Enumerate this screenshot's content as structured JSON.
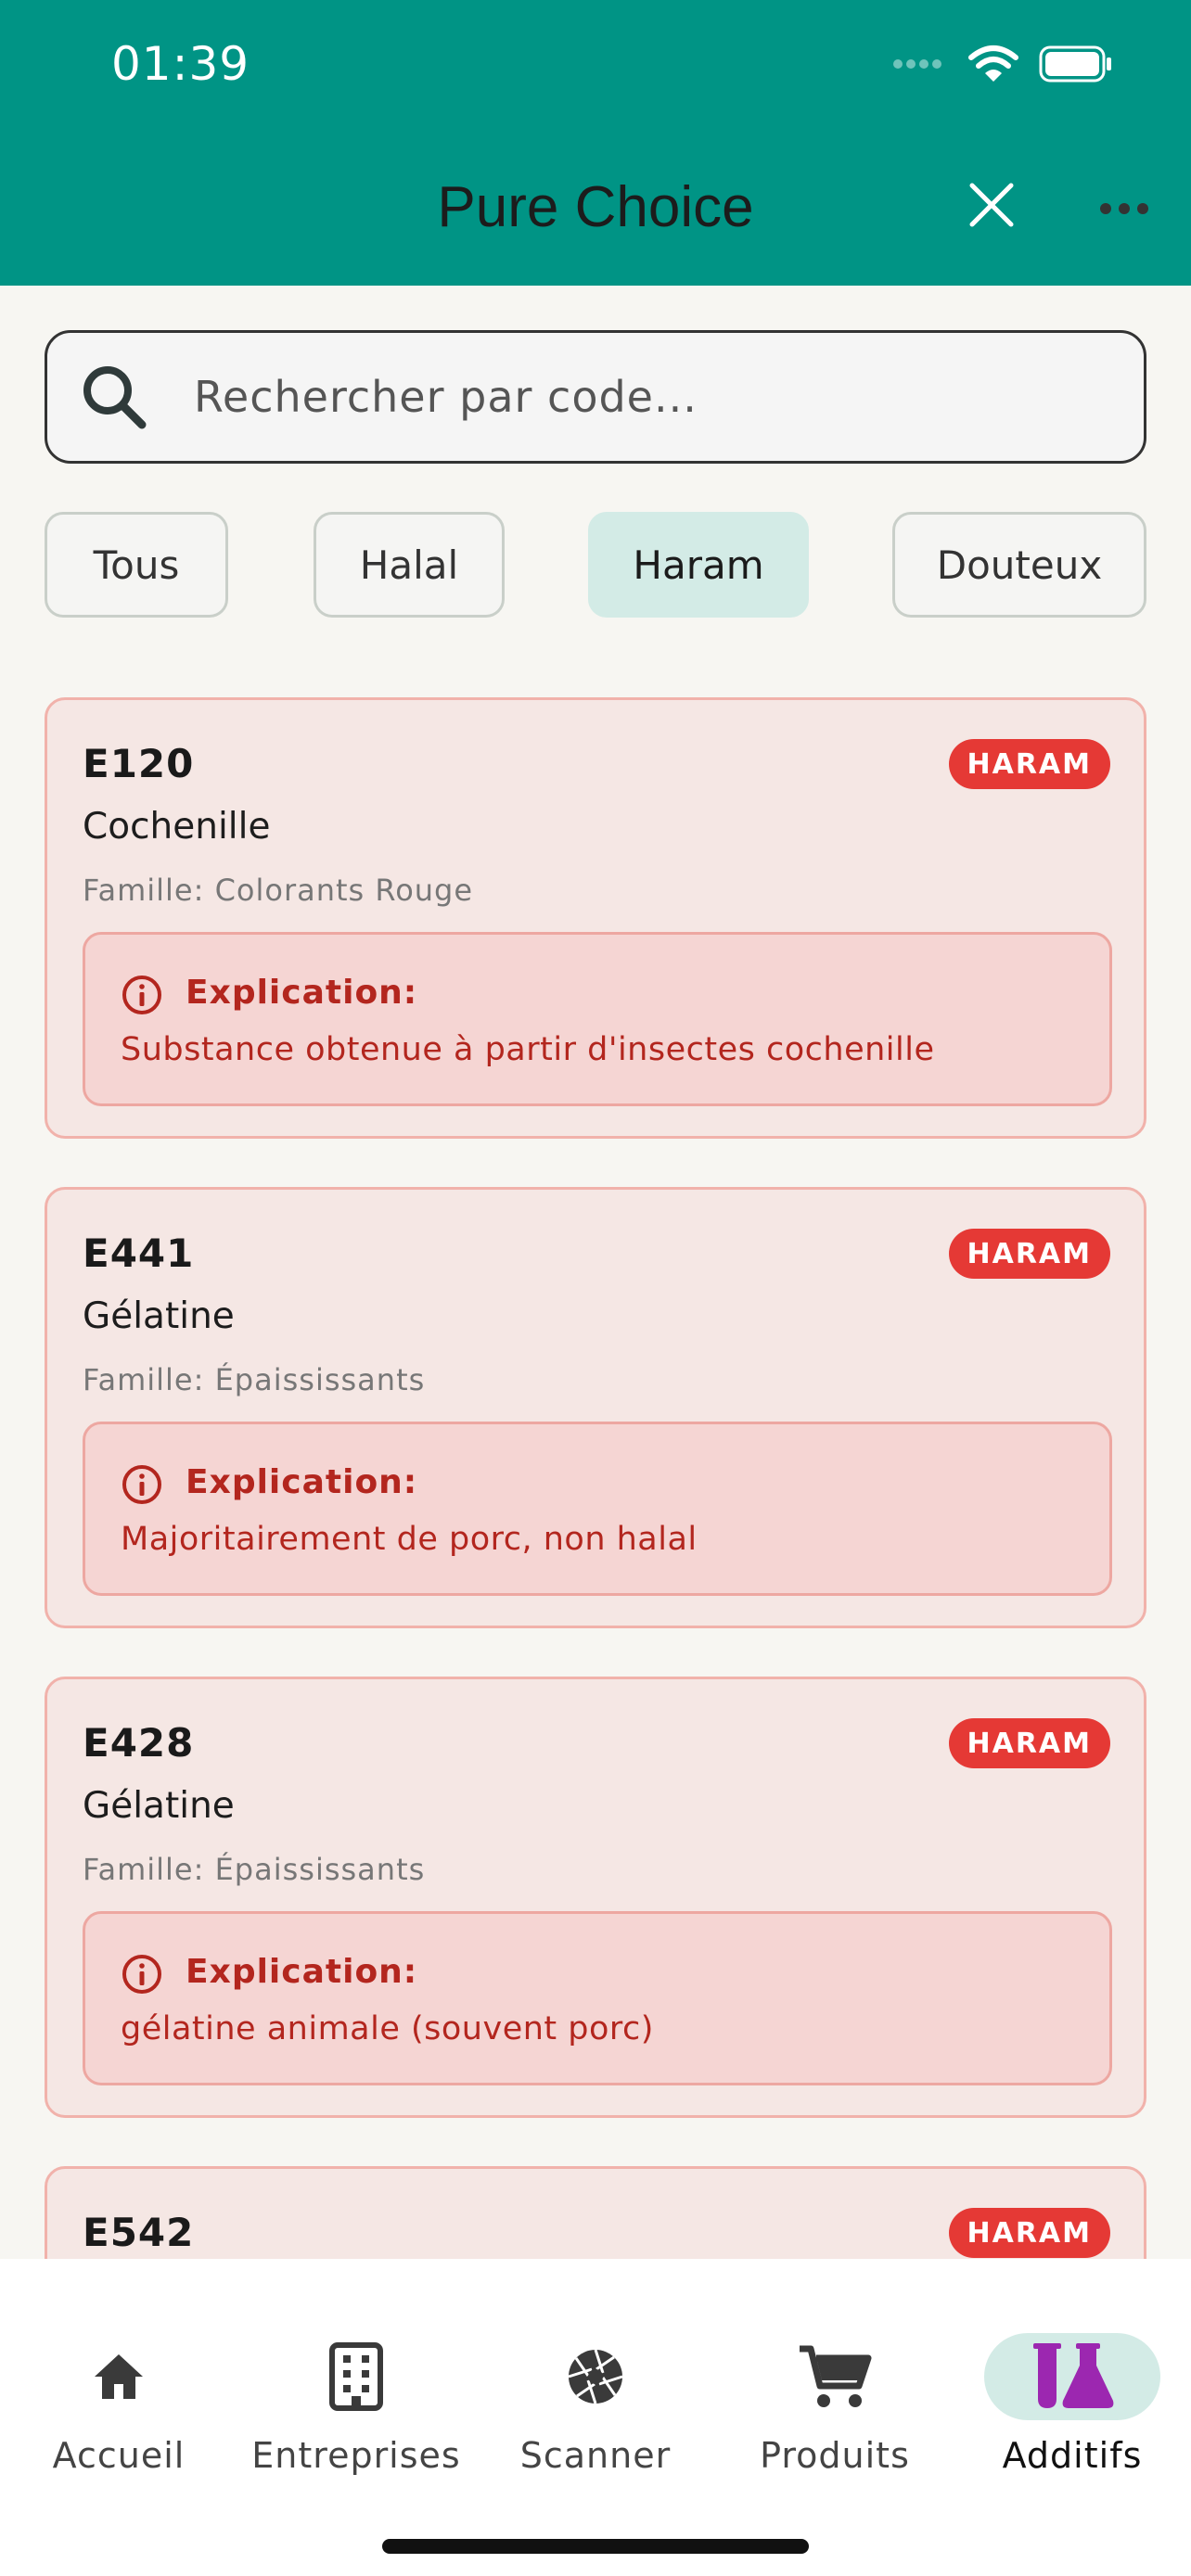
{
  "status": {
    "time": "01:39"
  },
  "header": {
    "title": "Pure Choice"
  },
  "search": {
    "placeholder": "Rechercher par code..."
  },
  "filters": [
    {
      "label": "Tous",
      "active": false
    },
    {
      "label": "Halal",
      "active": false
    },
    {
      "label": "Haram",
      "active": true
    },
    {
      "label": "Douteux",
      "active": false
    }
  ],
  "additives": [
    {
      "code": "E120",
      "badge": "HARAM",
      "name": "Cochenille",
      "family": "Famille: Colorants Rouge",
      "explain_title": "Explication:",
      "explain_text": "Substance obtenue à partir d'insectes cochenille"
    },
    {
      "code": "E441",
      "badge": "HARAM",
      "name": "Gélatine",
      "family": "Famille: Épaississants",
      "explain_title": "Explication:",
      "explain_text": " Majoritairement de porc, non halal"
    },
    {
      "code": "E428",
      "badge": "HARAM",
      "name": "Gélatine",
      "family": "Famille: Épaississants",
      "explain_title": "Explication:",
      "explain_text": "gélatine animale (souvent porc)"
    },
    {
      "code": "E542",
      "badge": "HARAM"
    }
  ],
  "nav": [
    {
      "label": "Accueil",
      "icon": "home-icon",
      "active": false
    },
    {
      "label": "Entreprises",
      "icon": "building-icon",
      "active": false
    },
    {
      "label": "Scanner",
      "icon": "aperture-icon",
      "active": false
    },
    {
      "label": "Produits",
      "icon": "cart-icon",
      "active": false
    },
    {
      "label": "Additifs",
      "icon": "flask-icon",
      "active": true
    }
  ],
  "colors": {
    "header": "#009485",
    "haram": "#e53935",
    "active_chip": "#d3ebe6",
    "nav_active_icon": "#9c27b0"
  }
}
